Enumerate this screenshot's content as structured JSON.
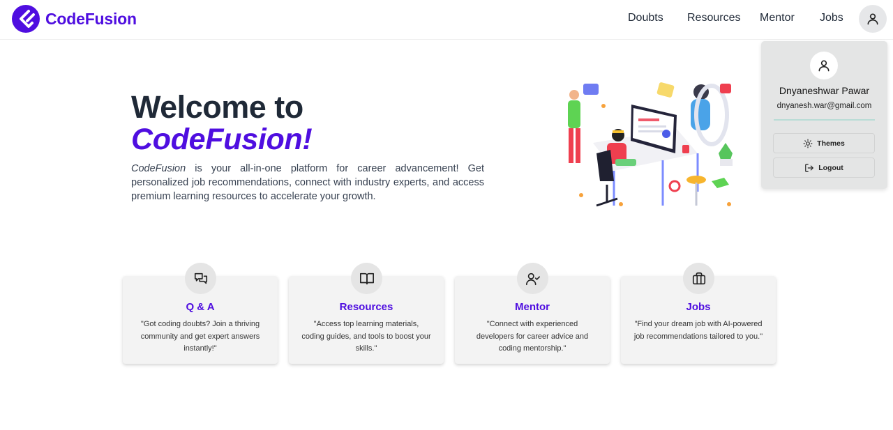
{
  "navbar": {
    "brand": "CodeFusion",
    "links": [
      "Doubts",
      "Resources",
      "Mentor",
      "Jobs"
    ]
  },
  "hero": {
    "title_line1": "Welcome to",
    "title_line2": "CodeFusion!",
    "description_brand": "CodeFusion",
    "description_rest": " is your all-in-one platform for career advancement! Get personalized job recommendations, connect with industry experts, and access premium learning resources to accelerate your growth."
  },
  "features": [
    {
      "title": "Q & A",
      "description": "\"Got coding doubts? Join a thriving community and get expert answers instantly!\"",
      "icon": "chat-bubbles-icon"
    },
    {
      "title": "Resources",
      "description": "\"Access top learning materials, coding guides, and tools to boost your skills.\"",
      "icon": "book-open-icon"
    },
    {
      "title": "Mentor",
      "description": "\"Connect with experienced developers for career advice and coding mentorship.\"",
      "icon": "user-check-icon"
    },
    {
      "title": "Jobs",
      "description": "\"Find your dream job with AI-powered job recommendations tailored to you.\"",
      "icon": "briefcase-icon"
    }
  ],
  "user_menu": {
    "name": "Dnyaneshwar Pawar",
    "email": "dnyanesh.war@gmail.com",
    "themes_label": "Themes",
    "logout_label": "Logout"
  },
  "colors": {
    "brand": "#4f0ee0",
    "card_bg": "#f3f3f3",
    "dropdown_bg": "#e4e5e5",
    "divider": "#b9dcd6"
  }
}
